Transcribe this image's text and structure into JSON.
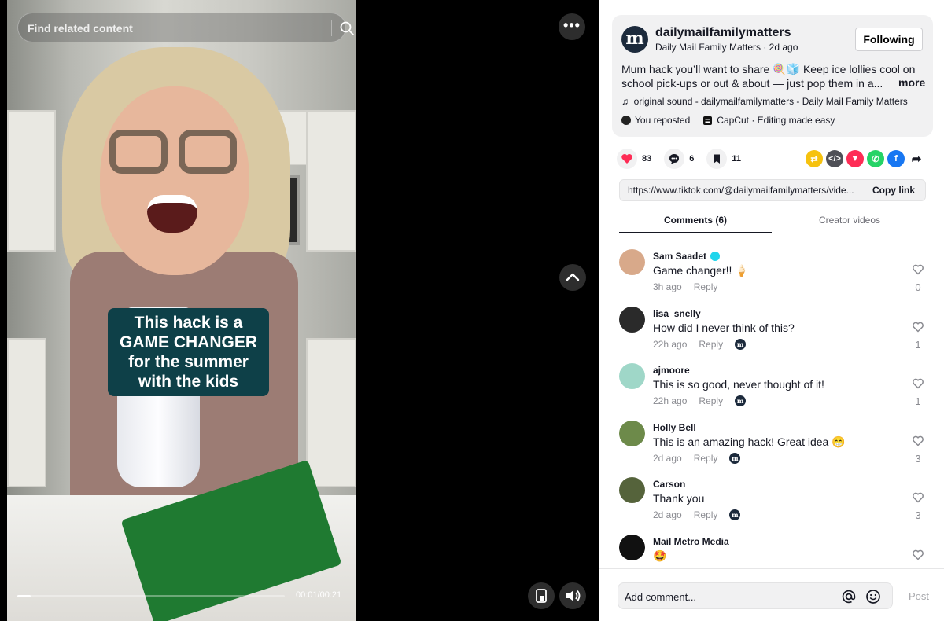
{
  "video": {
    "search_placeholder": "Find related content",
    "more_label": "•••",
    "caption_lines": [
      "This hack is a",
      "GAME CHANGER",
      "for the summer",
      "with the kids"
    ],
    "time": "00:01/00:21",
    "progress_fraction": 0.05
  },
  "creator": {
    "avatar_letter": "m",
    "username": "dailymailfamilymatters",
    "subline": "Daily Mail Family Matters · 2d ago",
    "follow_label": "Following",
    "description": "Mum hack you’ll want to share 🍭🧊 Keep ice lollies cool on school pick-ups or out & about — just pop them in a...",
    "more_label": "more",
    "sound": "original sound - dailymailfamilymatters - Daily Mail Family Matters",
    "reposted": "You reposted",
    "capcut": "CapCut · Editing made easy"
  },
  "actions": {
    "likes": "83",
    "comments": "6",
    "saves": "11"
  },
  "share_colors": {
    "repost": "#f6c20f",
    "embed": "#4f5057",
    "friends": "#fe2c55",
    "whatsapp": "#25d366",
    "facebook": "#1877f2"
  },
  "link": {
    "url": "https://www.tiktok.com/@dailymailfamilymatters/vide...",
    "copy_label": "Copy link"
  },
  "tabs": {
    "comments": "Comments (6)",
    "creator_videos": "Creator videos"
  },
  "comments": [
    {
      "user": "Sam Saadet",
      "text": "Game changer!! 🍦",
      "time": "3h ago",
      "reply": "Reply",
      "likes": "0",
      "color": "#d8a98a"
    },
    {
      "user": "lisa_snelly",
      "text": "How did I never think of this?",
      "time": "22h ago",
      "reply": "Reply",
      "likes": "1",
      "color": "#2a2a2a"
    },
    {
      "user": "ajmoore",
      "text": "This is so good, never thought of it!",
      "time": "22h ago",
      "reply": "Reply",
      "likes": "1",
      "color": "#9fd7c8"
    },
    {
      "user": "Holly Bell",
      "text": "This is an amazing hack! Great idea 😁",
      "time": "2d ago",
      "reply": "Reply",
      "likes": "3",
      "color": "#6d8a4a"
    },
    {
      "user": "Carson",
      "text": "Thank you",
      "time": "2d ago",
      "reply": "Reply",
      "likes": "3",
      "color": "#55633b"
    },
    {
      "user": "Mail Metro Media",
      "text": "🤩",
      "time": "",
      "reply": "",
      "likes": "",
      "color": "#111111"
    }
  ],
  "add_comment": {
    "placeholder": "Add comment...",
    "post_label": "Post"
  }
}
